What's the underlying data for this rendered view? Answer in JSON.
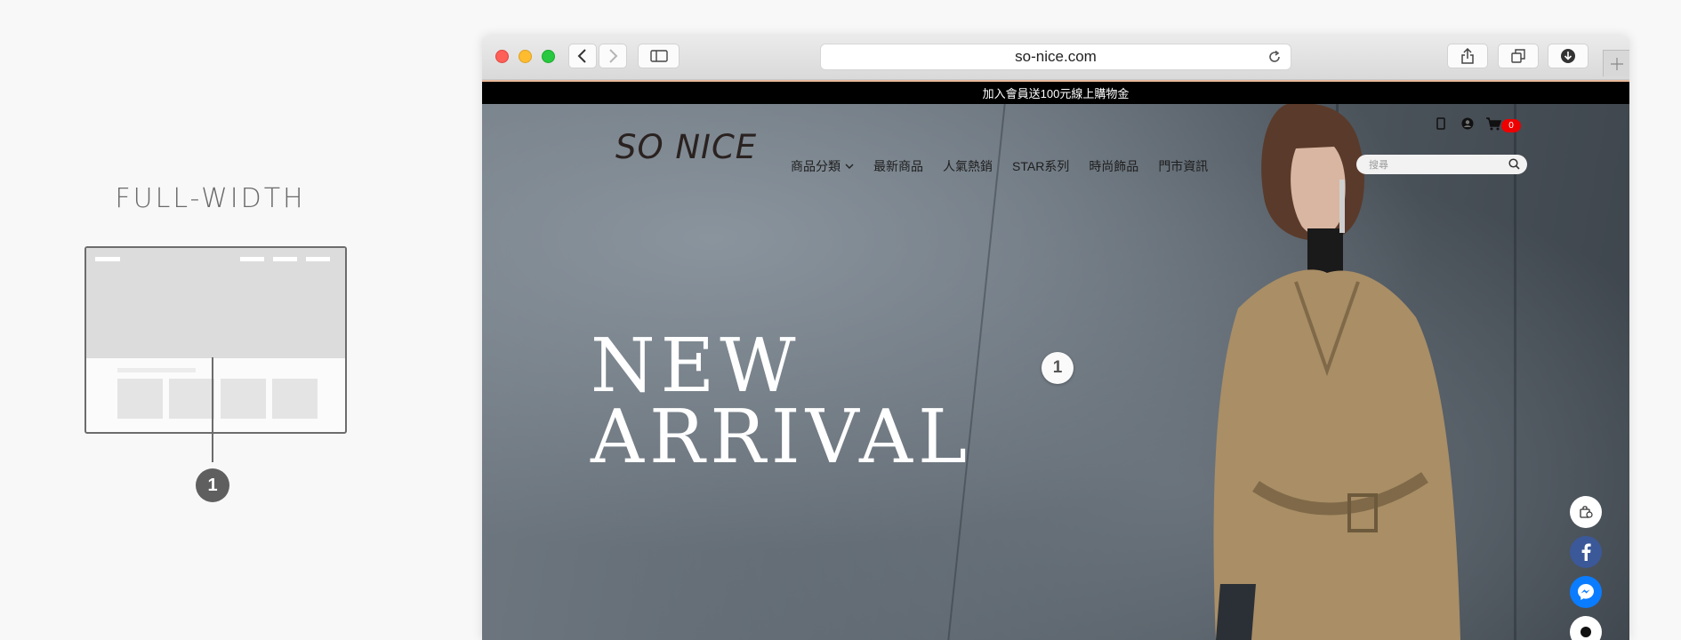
{
  "illustration": {
    "title": "FULL-WIDTH",
    "marker": "1"
  },
  "browser": {
    "url": "so-nice.com"
  },
  "site": {
    "announcement": "加入會員送100元線上購物金",
    "logo": "SO NICE",
    "nav": [
      {
        "label": "商品分類",
        "has_dropdown": true
      },
      {
        "label": "最新商品"
      },
      {
        "label": "人氣熱銷"
      },
      {
        "label": "STAR系列"
      },
      {
        "label": "時尚飾品"
      },
      {
        "label": "門市資訊"
      }
    ],
    "cart_count": "0",
    "search_placeholder": "搜尋",
    "hero": {
      "line1": "NEW",
      "line2": "ARRIVAL",
      "marker": "1"
    }
  },
  "colors": {
    "cart_badge": "#ee0000",
    "facebook": "#3b5998",
    "messenger": "#0a7cff"
  }
}
